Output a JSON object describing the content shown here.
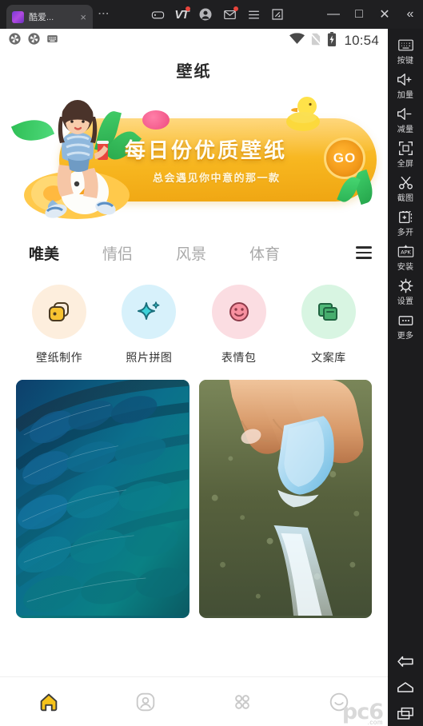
{
  "window": {
    "tab": {
      "title": "酷爱...",
      "favicon": "app-icon",
      "close": "×"
    },
    "tab_menu_icon": "kebab-menu-icon",
    "toolbar_icons": [
      {
        "name": "gamepad-icon",
        "badge": false
      },
      {
        "name": "vt-icon",
        "label": "VT",
        "badge": true
      },
      {
        "name": "account-avatar-icon",
        "badge": false
      },
      {
        "name": "mail-icon",
        "badge": true
      },
      {
        "name": "menu-icon",
        "badge": false
      },
      {
        "name": "resize-icon",
        "badge": false
      }
    ],
    "controls": {
      "minimize": "—",
      "maximize": "□",
      "close": "✕",
      "collapse": "«"
    }
  },
  "sidebar": {
    "items": [
      {
        "icon": "keyboard-icon",
        "label": "按键"
      },
      {
        "icon": "volume-up-icon",
        "label": "加量"
      },
      {
        "icon": "volume-down-icon",
        "label": "减量"
      },
      {
        "icon": "fullscreen-icon",
        "label": "全屏"
      },
      {
        "icon": "scissors-icon",
        "label": "截图"
      },
      {
        "icon": "multi-instance-icon",
        "label": "多开"
      },
      {
        "icon": "apk-install-icon",
        "label": "安装"
      },
      {
        "icon": "gear-icon",
        "label": "设置"
      },
      {
        "icon": "more-icon",
        "label": "更多"
      }
    ],
    "android_keys": [
      {
        "icon": "back-icon",
        "label": "back"
      },
      {
        "icon": "home-icon",
        "label": "home"
      },
      {
        "icon": "recents-icon",
        "label": "recents"
      }
    ]
  },
  "statusbar": {
    "left_icons": [
      "sync-icon",
      "sync-icon",
      "keyboard-icon"
    ],
    "right_icons": [
      "wifi-icon",
      "sim-off-icon",
      "battery-charging-icon"
    ],
    "time": "10:54"
  },
  "app": {
    "title": "壁纸",
    "banner": {
      "title": "每日份优质壁纸",
      "subtitle": "总会遇见你中意的那一款",
      "cta": "GO",
      "illustration": "girl-on-duck-float-illustration",
      "colors": {
        "pill": "#f7b61f",
        "cta_bg": "#f29313",
        "leaf": "#35c05a"
      }
    },
    "tabs": [
      {
        "label": "唯美",
        "active": true
      },
      {
        "label": "情侣",
        "active": false
      },
      {
        "label": "风景",
        "active": false
      },
      {
        "label": "体育",
        "active": false
      }
    ],
    "tabs_more_icon": "hamburger-icon",
    "tab_highlight_color": "#f6d33c",
    "quick_actions": [
      {
        "label": "壁纸制作",
        "icon": "stacked-cards-icon",
        "circle_color": "#fdeedd",
        "icon_color": "#f5b932"
      },
      {
        "label": "照片拼图",
        "icon": "sparkle-icon",
        "circle_color": "#d7f1fb",
        "icon_color": "#2fc6cf"
      },
      {
        "label": "表情包",
        "icon": "smiley-icon",
        "circle_color": "#fbdde2",
        "icon_color": "#ef6b84"
      },
      {
        "label": "文案库",
        "icon": "documents-icon",
        "circle_color": "#d8f5e2",
        "icon_color": "#3fa564"
      }
    ],
    "wallpapers": [
      {
        "name": "blue-teal-feathers-wallpaper",
        "alt": "蓝绿色羽毛"
      },
      {
        "name": "hand-blue-chalk-wallpaper",
        "alt": "手持蓝色粉笔"
      }
    ],
    "bottom_nav": [
      {
        "icon": "home-icon",
        "active": true
      },
      {
        "icon": "profile-icon",
        "active": false
      },
      {
        "icon": "grid-icon",
        "active": false
      },
      {
        "icon": "smiley-icon",
        "active": false
      }
    ],
    "bottom_nav_active_color": "#f5c21b"
  },
  "watermark": {
    "text": "pc6",
    "sub": ".com"
  }
}
